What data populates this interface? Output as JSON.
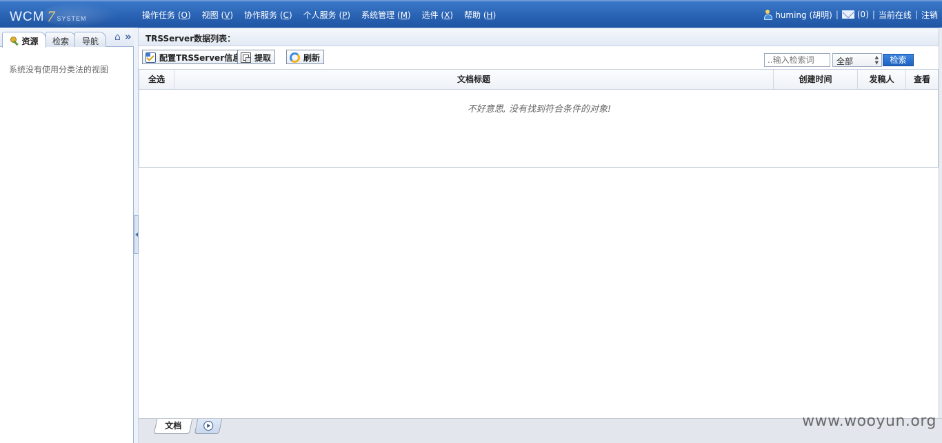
{
  "header": {
    "logo_main": "WCM",
    "logo_version": "7",
    "logo_sub": "SYSTEM",
    "menu": [
      {
        "label": "操作任务 (",
        "key": "O",
        "close": ")"
      },
      {
        "label": "视图 (",
        "key": "V",
        "close": ")"
      },
      {
        "label": "协作服务 (",
        "key": "C",
        "close": ")"
      },
      {
        "label": "个人服务 (",
        "key": "P",
        "close": ")"
      },
      {
        "label": "系统管理 (",
        "key": "M",
        "close": ")"
      },
      {
        "label": "选件 (",
        "key": "X",
        "close": ")"
      },
      {
        "label": "帮助 (",
        "key": "H",
        "close": ")"
      }
    ],
    "user": "huming (胡明)",
    "mail_count": "(0)",
    "online_link": "当前在线",
    "logout_link": "注销",
    "separator": "|",
    "icons": [
      "user-icon",
      "mail-icon"
    ]
  },
  "sidebar": {
    "tabs": [
      {
        "label": "资源"
      },
      {
        "label": "检索"
      },
      {
        "label": "导航"
      }
    ],
    "home_glyph": "⌂",
    "collapse_glyph": "»",
    "message": "系统没有使用分类法的视图"
  },
  "main": {
    "title": "TRSServer数据列表：",
    "toolbar": {
      "config_label": "配置TRSServer信息",
      "extract_label": "提取",
      "refresh_label": "刷新"
    },
    "search": {
      "placeholder": "..输入检索词",
      "scope_value": "全部",
      "button_label": "检索"
    },
    "table": {
      "columns": [
        "全选",
        "文档标题",
        "创建时间",
        "发稿人",
        "查看"
      ],
      "empty_message": "不好意思, 没有找到符合条件的对象!"
    }
  },
  "bottom_tabs": {
    "doc_label": "文档"
  },
  "watermark": "www.wooyun.org",
  "colors": {
    "topbar": "#2a63b4",
    "search_button": "#1f62bf",
    "logo_accent": "#f6d36a"
  }
}
